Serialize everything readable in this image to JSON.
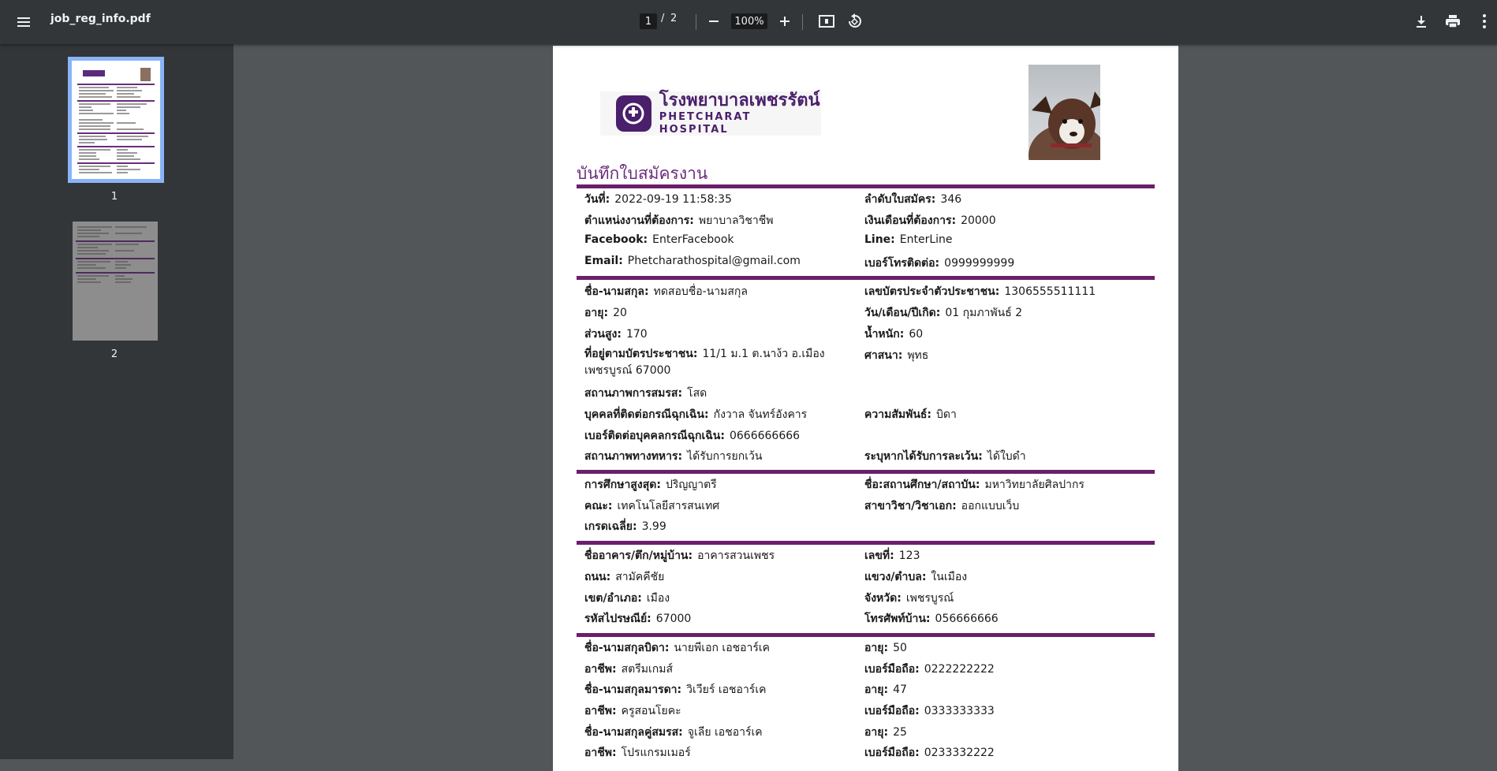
{
  "viewer": {
    "file_name": "job_reg_info.pdf",
    "current_page": "1",
    "page_separator": "/",
    "total_pages": "2",
    "zoom": "100%",
    "thumbnails": [
      {
        "label": "1"
      },
      {
        "label": "2"
      }
    ]
  },
  "logo": {
    "thai": "โรงพยาบาลเพชรรัตน์",
    "english": "PHETCHARAT HOSPITAL"
  },
  "document": {
    "heading": "บันทึกใบสมัครงาน",
    "date_label": "วันที่:",
    "date_value": "2022-09-19 11:58:35",
    "app_no_label": "ลำดับใบสมัคร:",
    "app_no_value": "346",
    "position_label": "ตำแหน่งงานที่ต้องการ:",
    "position_value": "พยาบาลวิชาชีพ",
    "salary_label": "เงินเดือนที่ต้องการ:",
    "salary_value": "20000",
    "facebook_label": "Facebook:",
    "facebook_value": "EnterFacebook",
    "line_label": "Line:",
    "line_value": "EnterLine",
    "email_label": "Email:",
    "email_value": "Phetcharathospital@gmail.com",
    "phone_label": "เบอร์โทรติดต่อ:",
    "phone_value": "0999999999",
    "name_label": "ชื่อ-นามสกุล:",
    "name_value": "ทดสอบชื่อ-นามสกุล",
    "idcard_label": "เลขบัตรประจำตัวประชาชน:",
    "idcard_value": "1306555511111",
    "age_label": "อายุ:",
    "age_value": "20",
    "dob_label": "วัน/เดือน/ปีเกิด:",
    "dob_value": "01 กุมภาพันธ์ 2",
    "height_label": "ส่วนสูง:",
    "height_value": "170",
    "weight_label": "น้ำหนัก:",
    "weight_value": "60",
    "address_label": "ที่อยู่ตามบัตรประชาชน:",
    "address_value": "11/1 ม.1 ต.นาง้ว อ.เมือง เพชรบูรณ์ 67000",
    "religion_label": "ศาสนา:",
    "religion_value": "พุทธ",
    "marital_label": "สถานภาพการสมรส:",
    "marital_value": "โสด",
    "emergency_label": "บุคคลที่ติดต่อกรณีฉุกเฉิน:",
    "emergency_value": "กังวาล จันทร์อังคาร",
    "relation_label": "ความสัมพันธ์:",
    "relation_value": "บิดา",
    "emergency_phone_label": "เบอร์ติดต่อบุคคลกรณีฉุกเฉิน:",
    "emergency_phone_value": "0666666666",
    "military_label": "สถานภาพทางทหาร:",
    "military_value": "ได้รับการยกเว้น",
    "exemption_label": "ระบุหากได้รับการละเว้น:",
    "exemption_value": "ได้ใบดำ",
    "education_label": "การศึกษาสูงสุด:",
    "education_value": "ปริญญาตรี",
    "institution_label": "ชื่อ:สถานศึกษา/สถาบัน:",
    "institution_value": "มหาวิทยาลัยศิลปากร",
    "faculty_label": "คณะ:",
    "faculty_value": "เทคโนโลยีสารสนเทศ",
    "major_label": "สาขาวิชา/วิชาเอก:",
    "major_value": "ออกแบบเว็บ",
    "gpa_label": "เกรดเฉลี่ย:",
    "gpa_value": "3.99",
    "building_label": "ชื่ออาคาร/ตึก/หมู่บ้าน:",
    "building_value": "อาคารสวนเพชร",
    "house_no_label": "เลขที่:",
    "house_no_value": "123",
    "road_label": "ถนน:",
    "road_value": "สามัคคีชัย",
    "subdistrict_label": "แขวง/ตำบล:",
    "subdistrict_value": "ในเมือง",
    "district_label": "เขต/อำเภอ:",
    "district_value": "เมือง",
    "province_label": "จังหวัด:",
    "province_value": "เพชรบูรณ์",
    "postal_label": "รหัสไปรษณีย์:",
    "postal_value": "67000",
    "home_phone_label": "โทรศัพท์บ้าน:",
    "home_phone_value": "056666666",
    "father_name_label": "ชื่อ-นามสกุลบิดา:",
    "father_name_value": "นายพีเอก เอชอาร์เค",
    "father_age_label": "อายุ:",
    "father_age_value": "50",
    "father_job_label": "อาชีพ:",
    "father_job_value": "สตรีมเกมส์",
    "father_mobile_label": "เบอร์มือถือ:",
    "father_mobile_value": "0222222222",
    "mother_name_label": "ชื่อ-นามสกุลมารดา:",
    "mother_name_value": "วิเวียร์ เอชอาร์เค",
    "mother_age_label": "อายุ:",
    "mother_age_value": "47",
    "mother_job_label": "อาชีพ:",
    "mother_job_value": "ครูสอนโยคะ",
    "mother_mobile_label": "เบอร์มือถือ:",
    "mother_mobile_value": "0333333333",
    "spouse_name_label": "ชื่อ-นามสกุลคู่สมรส:",
    "spouse_name_value": "จูเลีย เอชอาร์เค",
    "spouse_age_label": "อายุ:",
    "spouse_age_value": "25",
    "spouse_job_label": "อาชีพ:",
    "spouse_job_value": "โปรแกรมเมอร์",
    "spouse_mobile_label": "เบอร์มือถือ:",
    "spouse_mobile_value": "0233332222"
  }
}
